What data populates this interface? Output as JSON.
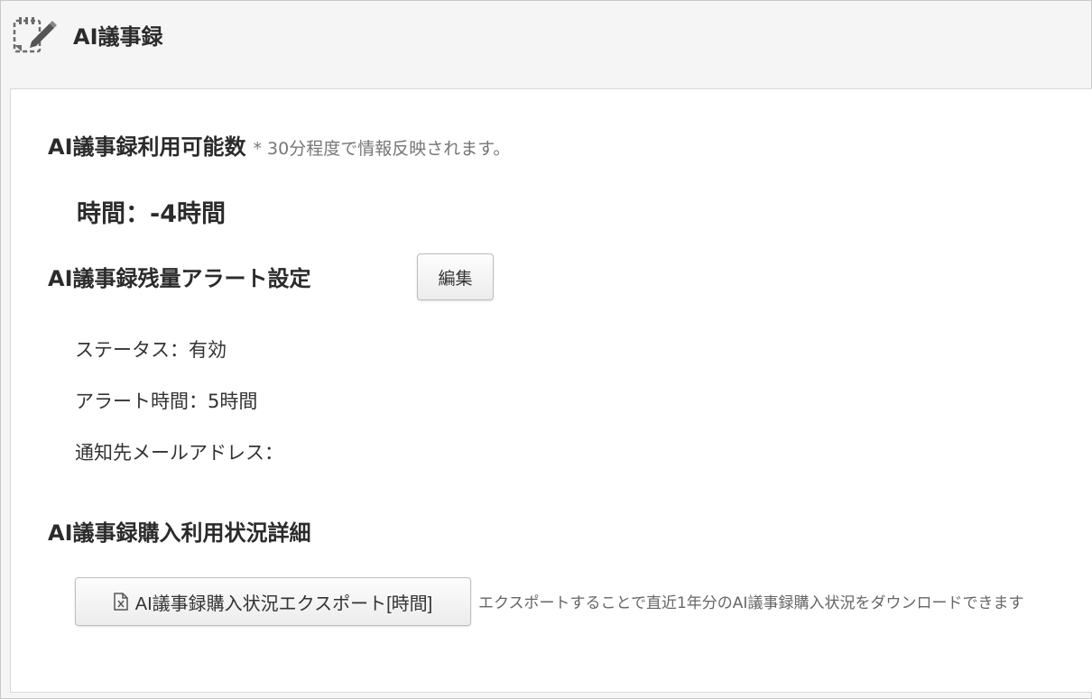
{
  "header": {
    "title": "AI議事録",
    "icon": "notebook-edit-icon"
  },
  "availability": {
    "title": "AI議事録利用可能数",
    "note": "* 30分程度で情報反映されます。",
    "hours_text": "時間：-4時間"
  },
  "alert": {
    "title": "AI議事録残量アラート設定",
    "edit_label": "編集",
    "status_text": "ステータス：有効",
    "alert_time_text": "アラート時間：5時間",
    "email_text": "通知先メールアドレス："
  },
  "purchase": {
    "title": "AI議事録購入利用状況詳細",
    "export_label": "AI議事録購入状況エクスポート[時間]",
    "export_icon": "excel-file-icon",
    "export_description": "エクスポートすることで直近1年分のAI議事録購入状況をダウンロードできます"
  }
}
